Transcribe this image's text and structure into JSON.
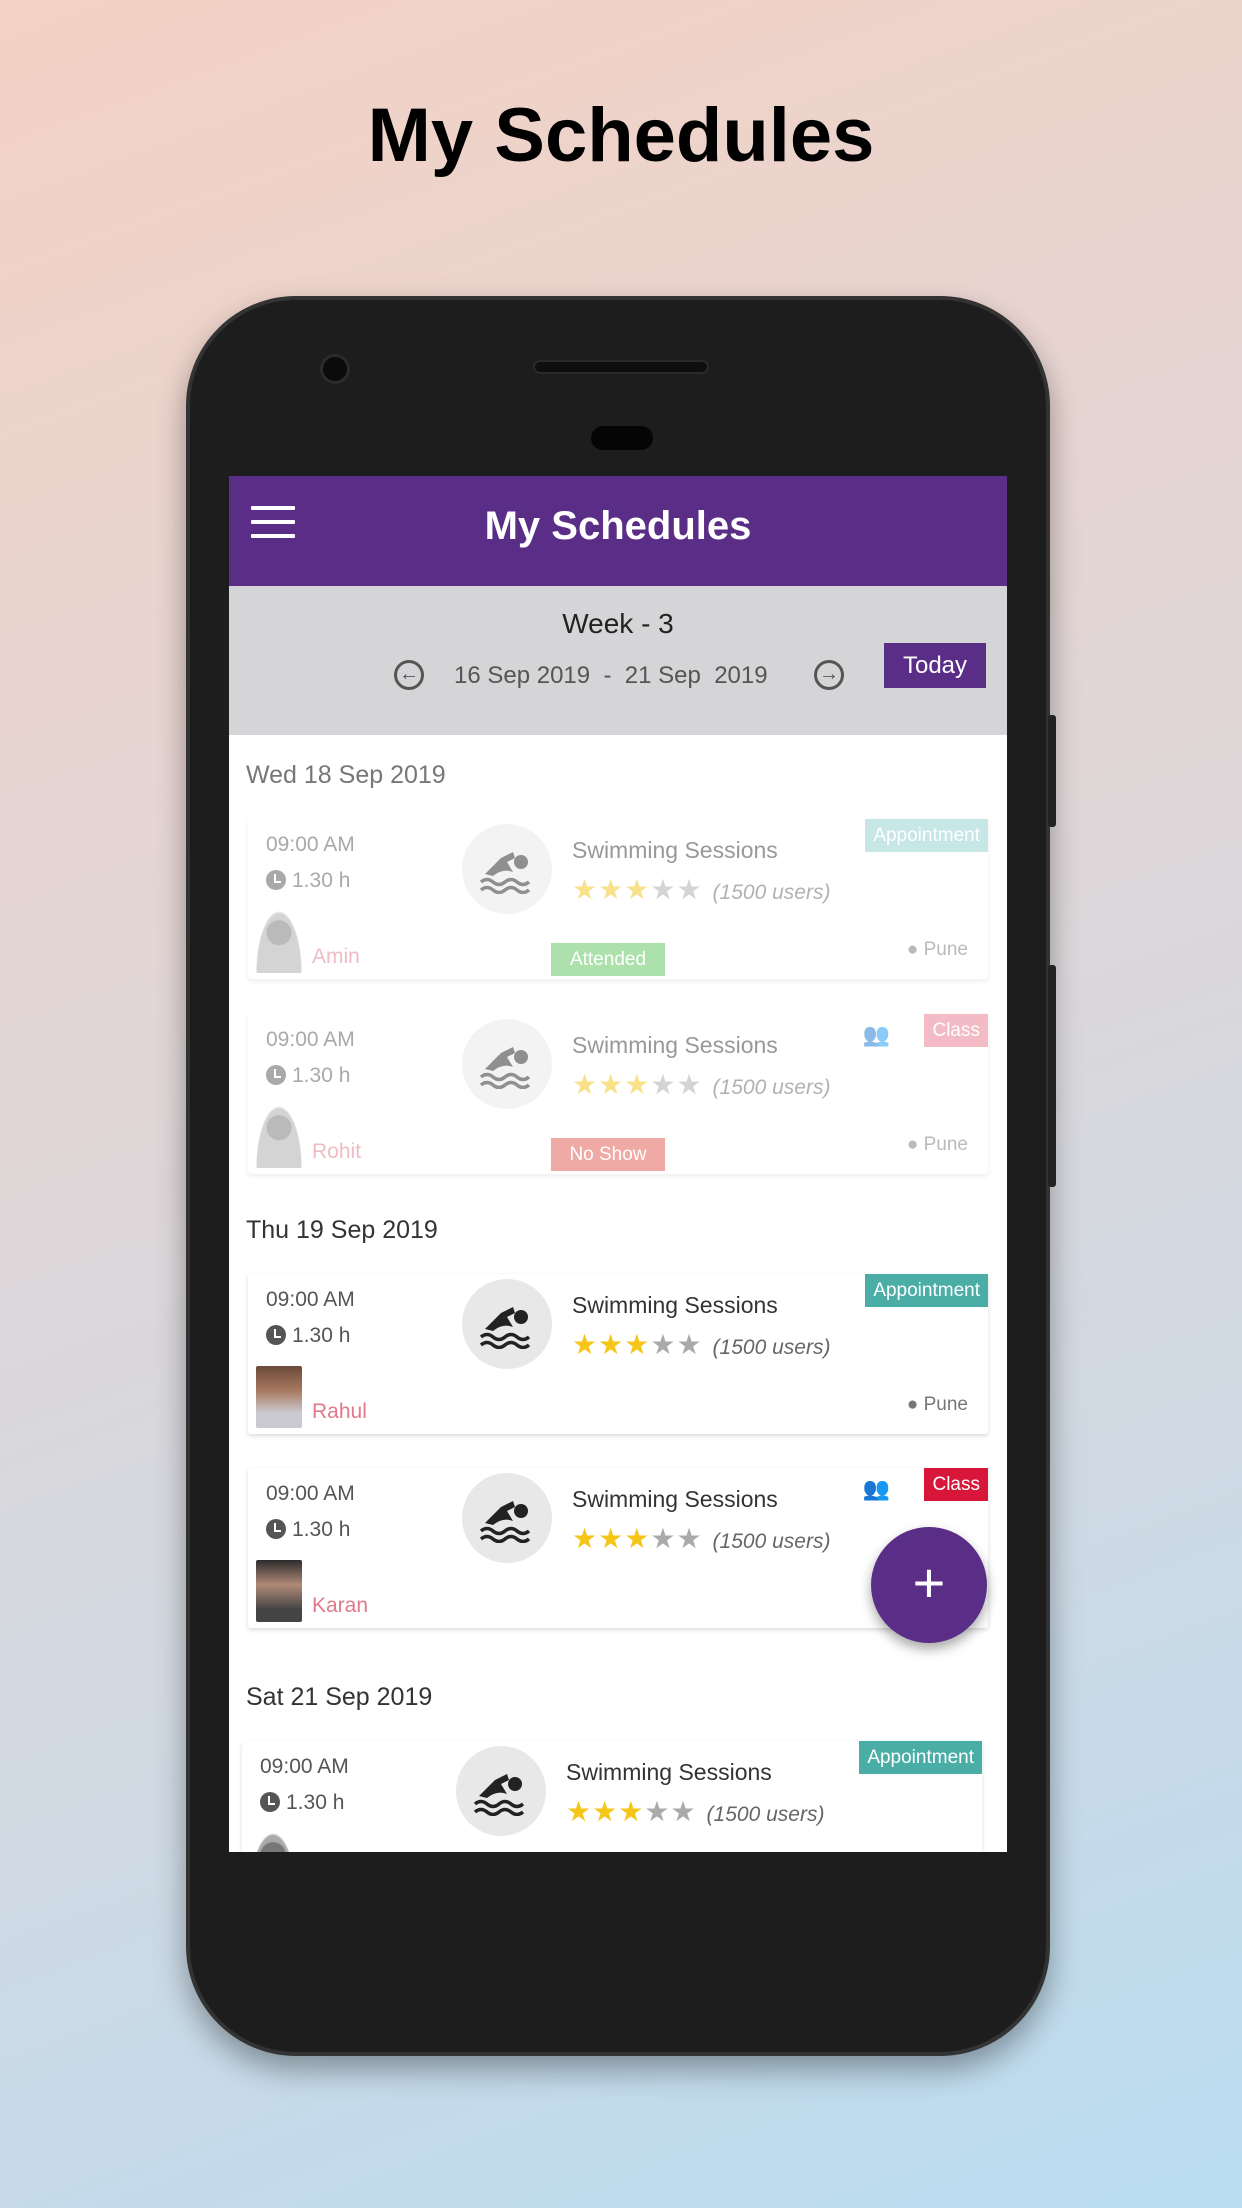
{
  "promo_title": "My Schedules",
  "appbar": {
    "title": "My Schedules",
    "menu_icon": "hamburger-icon"
  },
  "week": {
    "label": "Week - 3",
    "range": "16 Sep 2019  -  21 Sep  2019",
    "prev_icon": "arrow-left-circle-icon",
    "next_icon": "arrow-right-circle-icon",
    "today_label": "Today"
  },
  "colors": {
    "primary": "#5a2d87",
    "appointment": "#4aaea6",
    "class": "#d8163a",
    "attended": "#5cc45c",
    "no_show": "#e0574f",
    "name": "#e07a8a",
    "star": "#f5c518"
  },
  "days": [
    {
      "label": "Wed 18 Sep 2019"
    },
    {
      "label": "Thu 19 Sep 2019"
    },
    {
      "label": "Sat 21 Sep 2019"
    }
  ],
  "cards": [
    {
      "day": 0,
      "time": "09:00 AM",
      "duration": "1.30 h",
      "person": "Amin",
      "avatar": "placeholder",
      "title": "Swimming Sessions",
      "rating": 3,
      "max_rating": 5,
      "users": "(1500 users)",
      "type": "Appointment",
      "status": "Attended",
      "location": "Pune",
      "faded": true,
      "group": false
    },
    {
      "day": 0,
      "time": "09:00 AM",
      "duration": "1.30 h",
      "person": "Rohit",
      "avatar": "placeholder",
      "title": "Swimming Sessions",
      "rating": 3,
      "max_rating": 5,
      "users": "(1500 users)",
      "type": "Class",
      "status": "No Show",
      "location": "Pune",
      "faded": true,
      "group": true
    },
    {
      "day": 1,
      "time": "09:00 AM",
      "duration": "1.30 h",
      "person": "Rahul",
      "avatar": "photo",
      "title": "Swimming Sessions",
      "rating": 3,
      "max_rating": 5,
      "users": "(1500 users)",
      "type": "Appointment",
      "status": "",
      "location": "Pune",
      "faded": false,
      "group": false
    },
    {
      "day": 1,
      "time": "09:00 AM",
      "duration": "1.30 h",
      "person": "Karan",
      "avatar": "photo",
      "title": "Swimming Sessions",
      "rating": 3,
      "max_rating": 5,
      "users": "(1500 users)",
      "type": "Class",
      "status": "",
      "location": "",
      "faded": false,
      "group": true
    },
    {
      "day": 2,
      "time": "09:00 AM",
      "duration": "1.30 h",
      "person": "",
      "avatar": "placeholder",
      "title": "Swimming Sessions",
      "rating": 3,
      "max_rating": 5,
      "users": "(1500 users)",
      "type": "Appointment",
      "status": "",
      "location": "",
      "faded": false,
      "group": false
    }
  ],
  "fab": {
    "label": "+",
    "icon": "plus-icon"
  }
}
